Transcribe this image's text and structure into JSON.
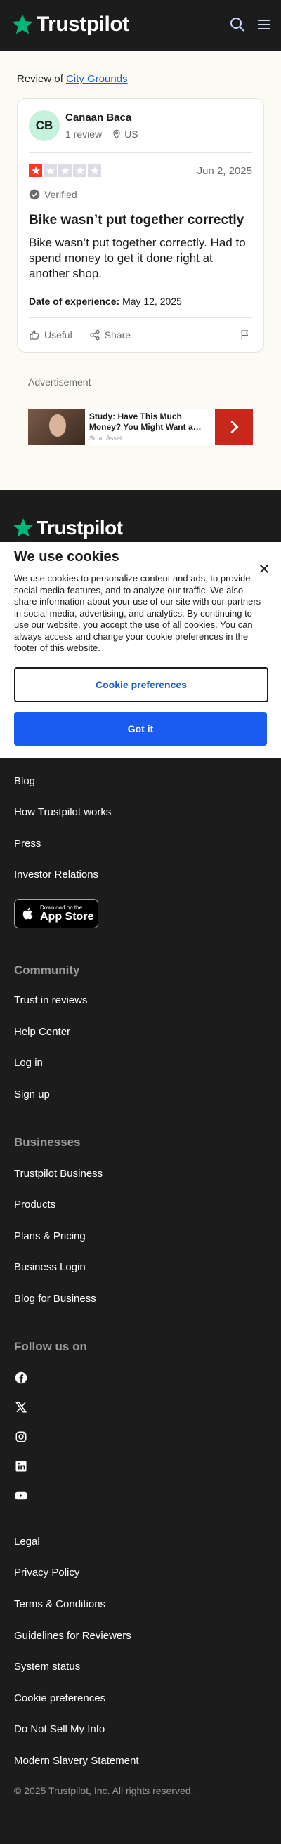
{
  "header": {
    "brand": "Trustpilot"
  },
  "breadcrumb": {
    "prefix": "Review of",
    "company": "City Grounds"
  },
  "review": {
    "initials": "CB",
    "author": "Canaan Baca",
    "review_count": "1 review",
    "country": "US",
    "rating": 1,
    "date": "Jun 2, 2025",
    "verified": "Verified",
    "title": "Bike wasn’t put together correctly",
    "body": "Bike wasn’t put together correctly. Had to spend money to get it done right at another shop.",
    "experience_label": "Date of experience:",
    "experience_date": "May 12, 2025",
    "useful": "Useful",
    "share": "Share"
  },
  "ad": {
    "label": "Advertisement",
    "title": "Study: Have This Much Money? You Might Want a…",
    "source": "SmartAsset"
  },
  "cookie": {
    "title": "We use cookies",
    "text": "We use cookies to personalize content and ads, to provide social media features, and to analyze our traffic. We also share information about your use of our site with our partners in social media, advertising, and analytics. By continuing to use our website, you accept the use of all cookies. You can always access and change your cookie preferences in the footer of this website.",
    "preferences": "Cookie preferences",
    "accept": "Got it"
  },
  "footer": {
    "brand": "Trustpilot",
    "about_links": [
      "Blog",
      "How Trustpilot works",
      "Press",
      "Investor Relations"
    ],
    "appstore_small": "Download on the",
    "appstore_big": "App Store",
    "community_title": "Community",
    "community_links": [
      "Trust in reviews",
      "Help Center",
      "Log in",
      "Sign up"
    ],
    "business_title": "Businesses",
    "business_links": [
      "Trustpilot Business",
      "Products",
      "Plans & Pricing",
      "Business Login",
      "Blog for Business"
    ],
    "follow_title": "Follow us on",
    "social_icons": [
      "facebook-icon",
      "x-icon",
      "instagram-icon",
      "linkedin-icon",
      "youtube-icon"
    ],
    "legal_links": [
      "Legal",
      "Privacy Policy",
      "Terms & Conditions",
      "Guidelines for Reviewers",
      "System status",
      "Cookie preferences",
      "Do Not Sell My Info",
      "Modern Slavery Statement"
    ],
    "copyright": "© 2025 Trustpilot, Inc. All rights reserved."
  },
  "colors": {
    "star": "#00b67a",
    "one_star": "#ff3722",
    "cta": "#1a5cf0",
    "link": "#1f5fd6"
  }
}
